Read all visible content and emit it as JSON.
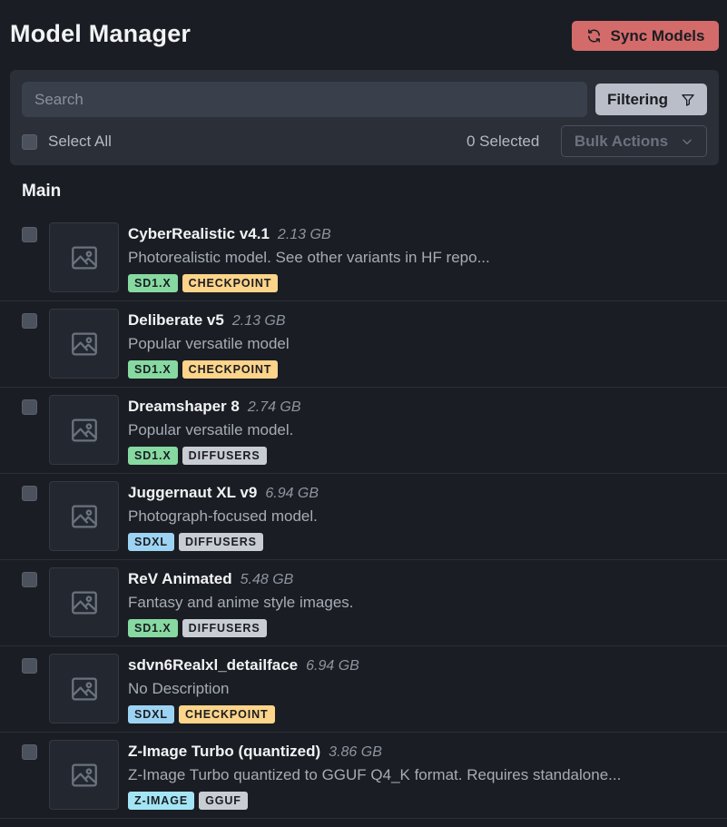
{
  "header": {
    "title": "Model Manager",
    "sync_label": "Sync Models"
  },
  "filters": {
    "search_placeholder": "Search",
    "search_value": "",
    "filter_label": "Filtering",
    "select_all_label": "Select All",
    "selected_count": "0 Selected",
    "bulk_actions_label": "Bulk Actions"
  },
  "section": {
    "title": "Main"
  },
  "tag_colors": {
    "SD1.X": "#86d9a0",
    "SDXL": "#9dd3f2",
    "Z-IMAGE": "#a3e5f5",
    "CHECKPOINT": "#fcd48a",
    "DIFFUSERS": "#c8ccd3",
    "GGUF": "#c8ccd3"
  },
  "colors": {
    "background": "#1a1d23",
    "panel": "#2a2f38",
    "sync_button": "#d46b6b",
    "filter_button": "#b9bec8"
  },
  "icons": {
    "sync": "refresh-icon",
    "filter": "filter-icon",
    "bulk": "chevron-down-icon",
    "thumbnail": "image-placeholder-icon"
  },
  "models": [
    {
      "name": "CyberRealistic v4.1",
      "size": "2.13 GB",
      "description": "Photorealistic model. See other variants in HF repo...",
      "tags": [
        "SD1.X",
        "CHECKPOINT"
      ]
    },
    {
      "name": "Deliberate v5",
      "size": "2.13 GB",
      "description": "Popular versatile model",
      "tags": [
        "SD1.X",
        "CHECKPOINT"
      ]
    },
    {
      "name": "Dreamshaper 8",
      "size": "2.74 GB",
      "description": "Popular versatile model.",
      "tags": [
        "SD1.X",
        "DIFFUSERS"
      ]
    },
    {
      "name": "Juggernaut XL v9",
      "size": "6.94 GB",
      "description": "Photograph-focused model.",
      "tags": [
        "SDXL",
        "DIFFUSERS"
      ]
    },
    {
      "name": "ReV Animated",
      "size": "5.48 GB",
      "description": "Fantasy and anime style images.",
      "tags": [
        "SD1.X",
        "DIFFUSERS"
      ]
    },
    {
      "name": "sdvn6Realxl_detailface",
      "size": "6.94 GB",
      "description": "No Description",
      "tags": [
        "SDXL",
        "CHECKPOINT"
      ]
    },
    {
      "name": "Z-Image Turbo (quantized)",
      "size": "3.86 GB",
      "description": "Z-Image Turbo quantized to GGUF Q4_K format. Requires standalone...",
      "tags": [
        "Z-IMAGE",
        "GGUF"
      ]
    }
  ]
}
